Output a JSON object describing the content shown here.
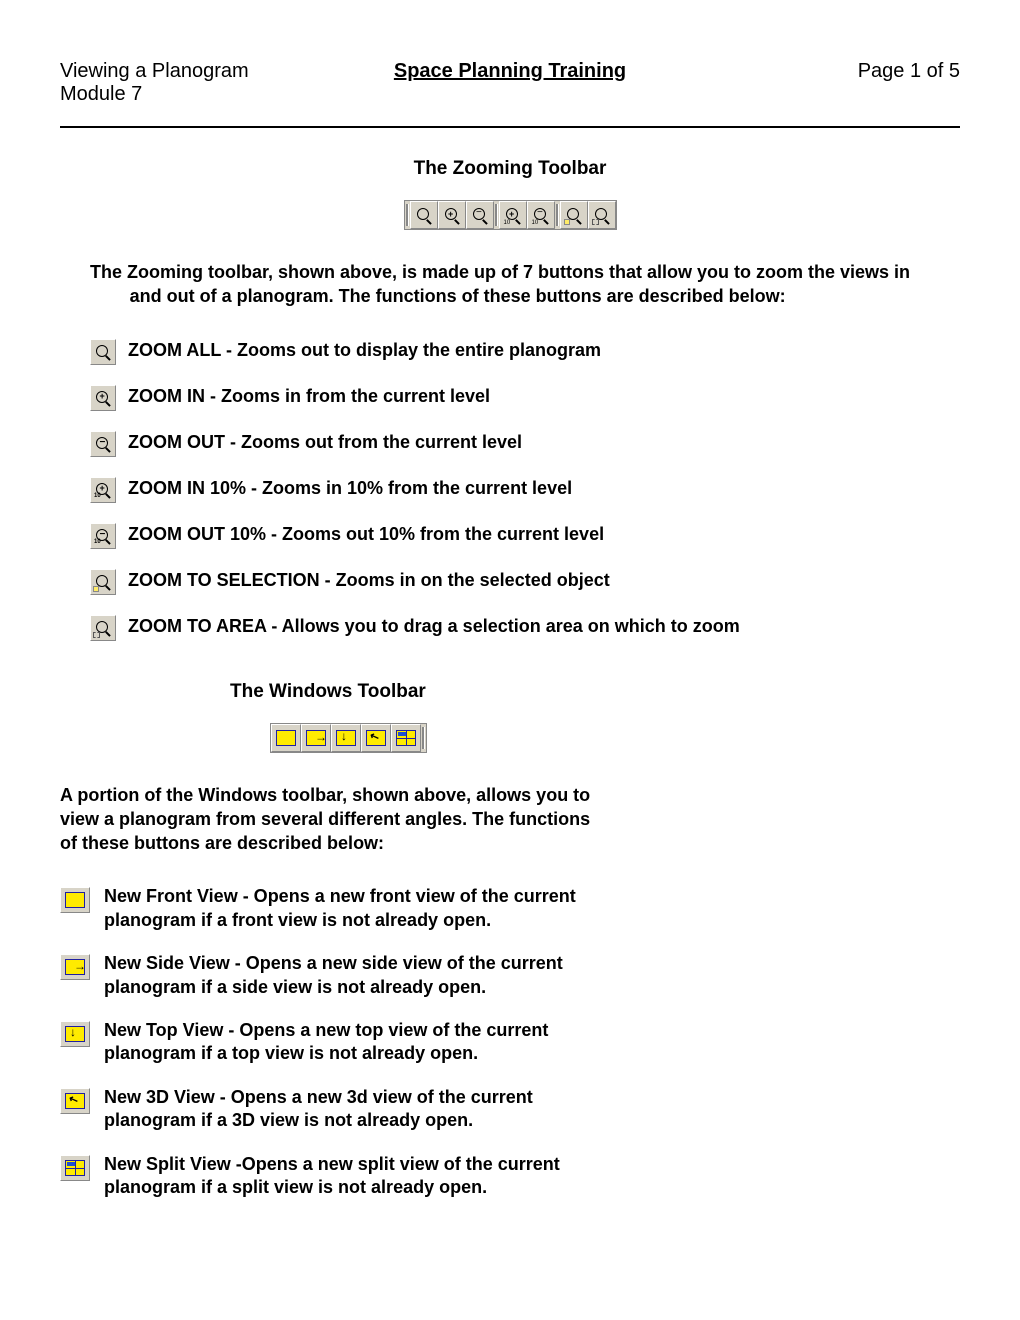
{
  "header": {
    "left_line1": "Viewing a Planogram",
    "left_line2": "Module 7",
    "center": "Space Planning Training",
    "right": "Page 1 of 5"
  },
  "zoom_section": {
    "title": "The Zooming Toolbar",
    "intro": "The Zooming toolbar, shown above, is made up of 7 buttons that allow you to zoom the views in and out of a planogram. The functions of these buttons are described below:",
    "items": [
      "ZOOM ALL - Zooms out to display the entire planogram",
      "ZOOM IN - Zooms in from the current level",
      "ZOOM OUT - Zooms out from the current level",
      "ZOOM IN 10% - Zooms in 10% from the current level",
      "ZOOM OUT 10% - Zooms out 10% from the current level",
      "ZOOM TO SELECTION - Zooms in on the selected object",
      "ZOOM TO AREA - Allows you to drag a selection area on which to zoom"
    ]
  },
  "windows_section": {
    "title": "The Windows Toolbar",
    "intro": "A portion of the Windows toolbar, shown above, allows you to view a planogram from several different angles. The functions of these buttons are described below:",
    "items": [
      "New Front View - Opens a new front view of the current planogram if a front view is not already open.",
      "New Side View - Opens a new side view of the current planogram if a side view is not already open.",
      "New Top View - Opens a new top view of the current planogram if a top view is not already open.",
      "New 3D View - Opens a new 3d view of the current planogram if a 3D view is not already open.",
      "New Split View -Opens a new split view of the current planogram if a split view is not already open."
    ]
  }
}
